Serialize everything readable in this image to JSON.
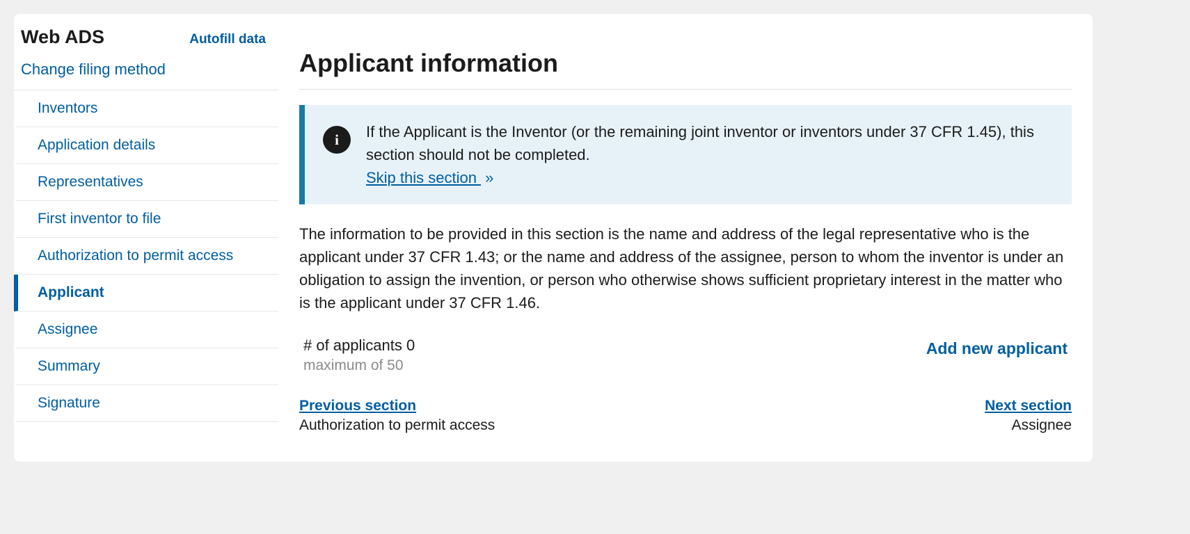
{
  "sidebar": {
    "title": "Web ADS",
    "autofill": "Autofill data",
    "changeFiling": "Change filing method",
    "items": [
      {
        "label": "Inventors",
        "active": false
      },
      {
        "label": "Application details",
        "active": false
      },
      {
        "label": "Representatives",
        "active": false
      },
      {
        "label": "First inventor to file",
        "active": false
      },
      {
        "label": "Authorization to permit access",
        "active": false
      },
      {
        "label": "Applicant",
        "active": true
      },
      {
        "label": "Assignee",
        "active": false
      },
      {
        "label": "Summary",
        "active": false
      },
      {
        "label": "Signature",
        "active": false
      }
    ]
  },
  "main": {
    "title": "Applicant information",
    "banner": {
      "text": "If the Applicant is the Inventor (or the remaining joint inventor or inventors under 37 CFR 1.45), this section should not be completed.",
      "skipLabel": " Skip this section ",
      "arrow": "»"
    },
    "description": "The information to be provided in this section is the name and address of the legal representative who is the applicant under 37 CFR 1.43; or the name and address of the assignee, person to whom the inventor is under an obligation to assign the invention, or person who otherwise shows sufficient proprietary interest in the matter who is the applicant under 37 CFR 1.46.",
    "counter": {
      "label": "# of applicants 0",
      "max": "maximum of 50"
    },
    "addLink": "Add new applicant",
    "prev": {
      "link": "Previous section",
      "name": "Authorization to permit access"
    },
    "next": {
      "link": "Next section",
      "name": "Assignee"
    }
  }
}
